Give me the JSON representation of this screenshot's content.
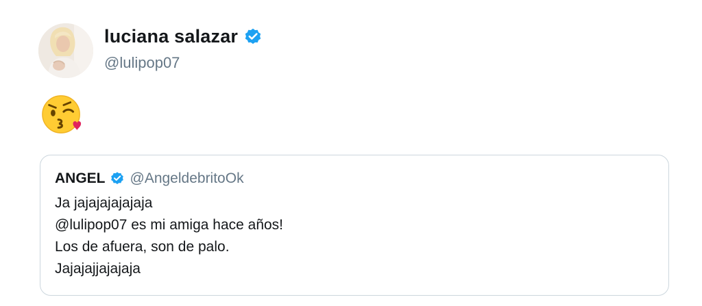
{
  "tweet": {
    "author": {
      "display_name": "luciana salazar",
      "handle": "@lulipop07",
      "verified_icon": "verified-badge-icon",
      "avatar": "profile-photo"
    },
    "body_emoji": "face-blowing-a-kiss-icon"
  },
  "quoted_tweet": {
    "display_name": "ANGEL",
    "handle": "@AngeldebritoOk",
    "verified_icon": "verified-badge-icon",
    "lines": [
      "Ja jajajajajajaja",
      "@lulipop07 es mi amiga hace años!",
      "Los de afuera, son de palo.",
      "Jajajajjajajaja"
    ]
  },
  "colors": {
    "verified": "#1da1f2",
    "secondary_text": "#657786",
    "border": "#ccd6dd"
  }
}
